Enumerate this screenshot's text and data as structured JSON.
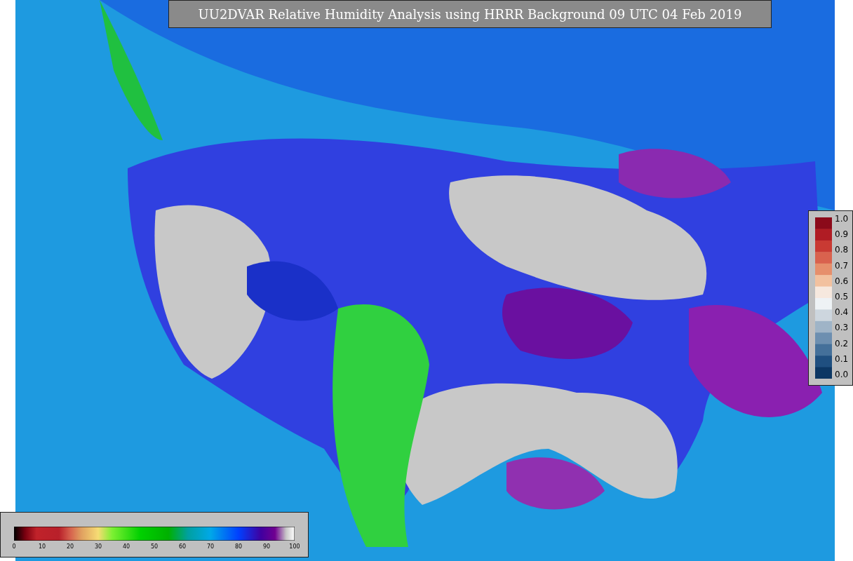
{
  "title": "UU2DVAR Relative Humidity Analysis using HRRR Background 09 UTC 04 Feb 2019",
  "side_legend": {
    "ticks": [
      "1.0",
      "0.9",
      "0.8",
      "0.7",
      "0.6",
      "0.5",
      "0.4",
      "0.3",
      "0.2",
      "0.1",
      "0.0"
    ]
  },
  "bottom_legend": {
    "ticks": [
      "0",
      "10",
      "20",
      "30",
      "40",
      "50",
      "60",
      "70",
      "80",
      "90",
      "100"
    ]
  }
}
